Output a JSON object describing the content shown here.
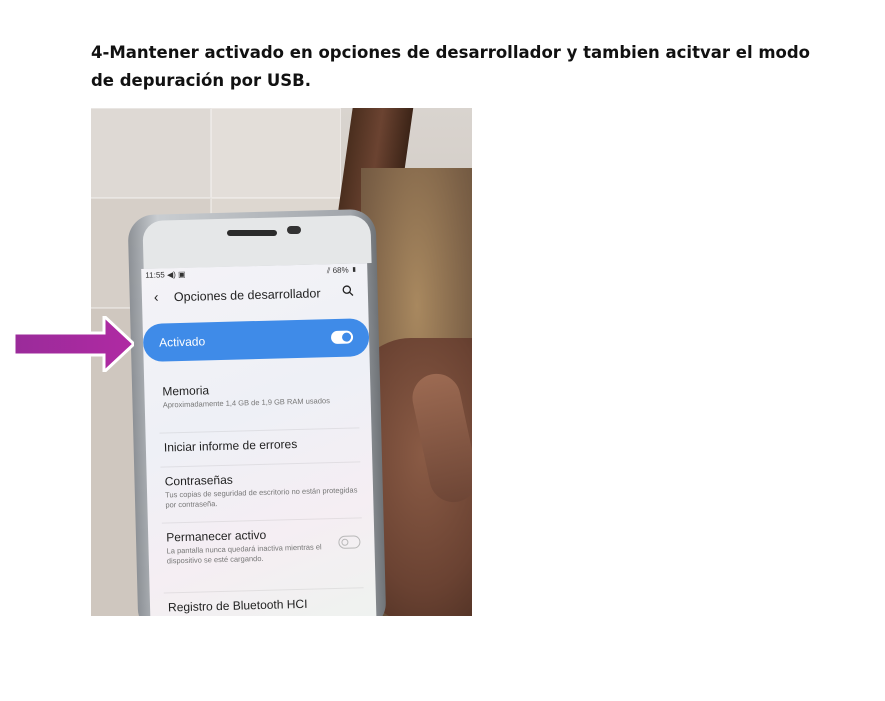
{
  "instruction": {
    "text": "4-Mantener activado en opciones de desarrollador y tambien acitvar el modo de depuración por USB."
  },
  "photo": {
    "status_bar": {
      "time": "11:55 ◀) ▣",
      "battery": "⫽ 68% ▮"
    },
    "screen_title": "Opciones de desarrollador",
    "activated": {
      "label": "Activado",
      "enabled": true
    },
    "settings": [
      {
        "title": "Memoria",
        "description": "Aproximadamente 1,4 GB de 1,9 GB RAM usados"
      },
      {
        "title": "Iniciar informe de errores",
        "description": ""
      },
      {
        "title": "Contraseñas",
        "description": "Tus copias de seguridad de escritorio no están protegidas por contraseña."
      },
      {
        "title": "Permanecer activo",
        "description": "La pantalla nunca quedará inactiva mientras el dispositivo se esté cargando.",
        "enabled": false
      },
      {
        "title": "Registro de Bluetooth HCI",
        "description": ""
      }
    ]
  },
  "colors": {
    "accent_blue": "#3f8be8",
    "arrow_purple": "#a12a9e"
  },
  "icons": [
    "back-chevron-icon",
    "search-icon",
    "toggle-on-icon",
    "toggle-off-icon",
    "arrow-right-icon"
  ]
}
